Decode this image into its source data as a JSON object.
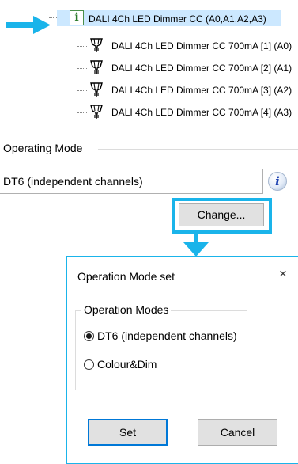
{
  "tree": {
    "root_label": "DALI 4Ch LED Dimmer CC (A0,A1,A2,A3)",
    "info_glyph": "i",
    "children": [
      {
        "label": "DALI 4Ch LED Dimmer CC 700mA [1] (A0)"
      },
      {
        "label": "DALI 4Ch LED Dimmer CC 700mA [2] (A1)"
      },
      {
        "label": "DALI 4Ch LED Dimmer CC 700mA [3] (A2)"
      },
      {
        "label": "DALI 4Ch LED Dimmer CC 700mA [4] (A3)"
      }
    ]
  },
  "operating_mode": {
    "group_label": "Operating Mode",
    "value": "DT6 (independent channels)",
    "info_glyph": "i",
    "change_label": "Change..."
  },
  "dialog": {
    "title": "Operation Mode set",
    "close_glyph": "×",
    "group_label": "Operation Modes",
    "options": [
      {
        "label": "DT6 (independent channels)",
        "checked": true
      },
      {
        "label": "Colour&Dim",
        "checked": false
      }
    ],
    "set_label": "Set",
    "cancel_label": "Cancel"
  },
  "colors": {
    "annotation": "#1ab4ea",
    "selection": "#cce8ff",
    "button_face": "#e1e1e1"
  }
}
